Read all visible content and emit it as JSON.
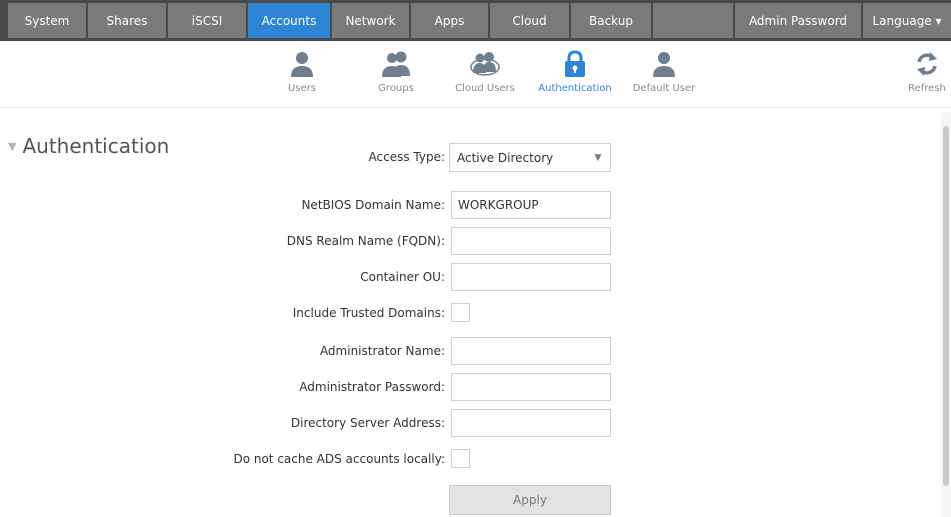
{
  "topnav": {
    "tabs": [
      {
        "label": "System"
      },
      {
        "label": "Shares"
      },
      {
        "label": "iSCSI"
      },
      {
        "label": "Accounts",
        "active": true
      },
      {
        "label": "Network"
      },
      {
        "label": "Apps"
      },
      {
        "label": "Cloud"
      },
      {
        "label": "Backup"
      }
    ],
    "admin_password": "Admin Password",
    "language": "Language ▾"
  },
  "subnav": {
    "items": [
      {
        "label": "Users",
        "icon": "user-icon"
      },
      {
        "label": "Groups",
        "icon": "group-icon"
      },
      {
        "label": "Cloud Users",
        "icon": "cloud-users-icon"
      },
      {
        "label": "Authentication",
        "icon": "lock-icon",
        "active": true
      },
      {
        "label": "Default User",
        "icon": "default-user-icon"
      }
    ],
    "refresh": "Refresh"
  },
  "section": {
    "title": "Authentication"
  },
  "form": {
    "access_type_label": "Access Type:",
    "access_type_value": "Active Directory",
    "netbios_label": "NetBIOS Domain Name:",
    "netbios_value": "WORKGROUP",
    "dns_realm_label": "DNS Realm Name (FQDN):",
    "dns_realm_value": "",
    "container_ou_label": "Container OU:",
    "container_ou_value": "",
    "trusted_domains_label": "Include Trusted Domains:",
    "admin_name_label": "Administrator Name:",
    "admin_name_value": "",
    "admin_password_label": "Administrator Password:",
    "admin_password_value": "",
    "dir_server_label": "Directory Server Address:",
    "dir_server_value": "",
    "no_cache_label": "Do not cache ADS accounts locally:",
    "apply_label": "Apply"
  },
  "colors": {
    "nav_bg": "#4a4a4a",
    "tab_bg": "#7a7a7a",
    "accent": "#2d85d3",
    "icon_gray": "#6f7f8f"
  }
}
